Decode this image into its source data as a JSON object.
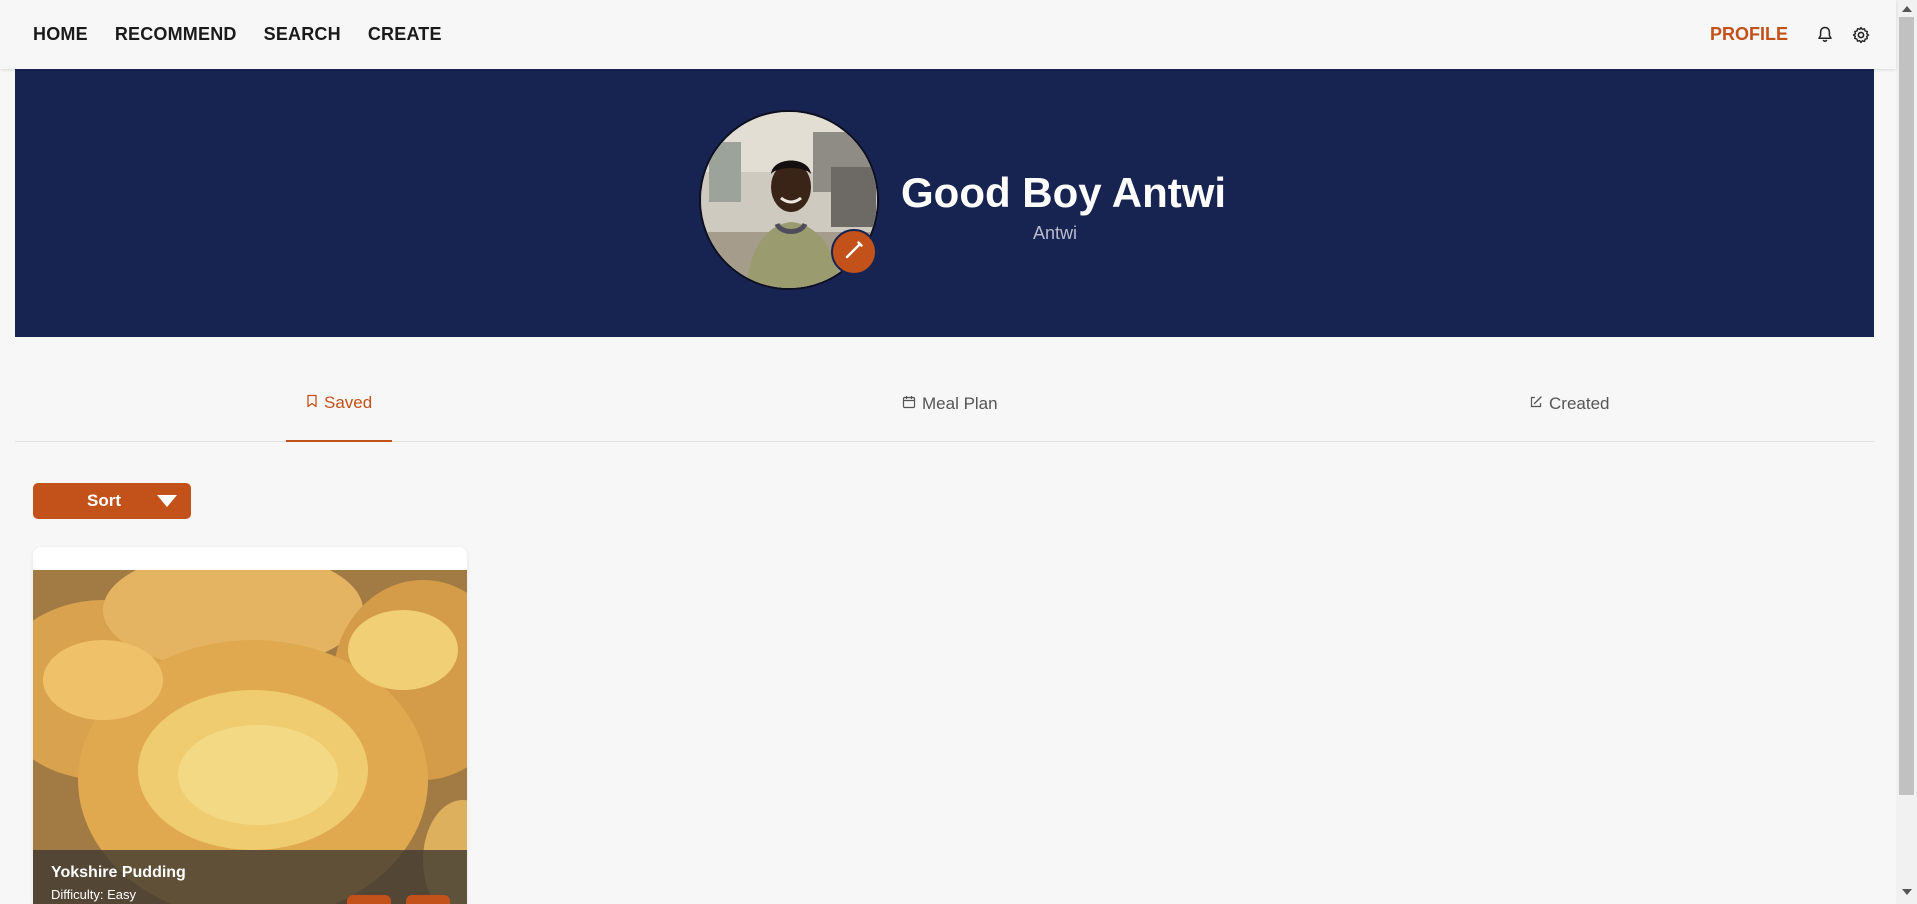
{
  "nav": {
    "links": [
      "HOME",
      "RECOMMEND",
      "SEARCH",
      "CREATE"
    ],
    "profile_label": "PROFILE",
    "icons": [
      "bell-icon",
      "gear-icon"
    ]
  },
  "profile": {
    "display_name": "Good Boy Antwi",
    "username": "Antwi",
    "edit_icon": "pencil-icon"
  },
  "tabs": [
    {
      "label": "Saved",
      "icon": "bookmark-icon",
      "active": true
    },
    {
      "label": "Meal Plan",
      "icon": "calendar-icon",
      "active": false
    },
    {
      "label": "Created",
      "icon": "edit-square-icon",
      "active": false
    }
  ],
  "sort": {
    "label": "Sort",
    "icon": "caret-down-icon"
  },
  "recipes": [
    {
      "title": "Yokshire Pudding",
      "difficulty": "Difficulty: Easy"
    }
  ],
  "colors": {
    "accent": "#c2511a",
    "banner": "#172452",
    "background": "#f7f7f7"
  }
}
